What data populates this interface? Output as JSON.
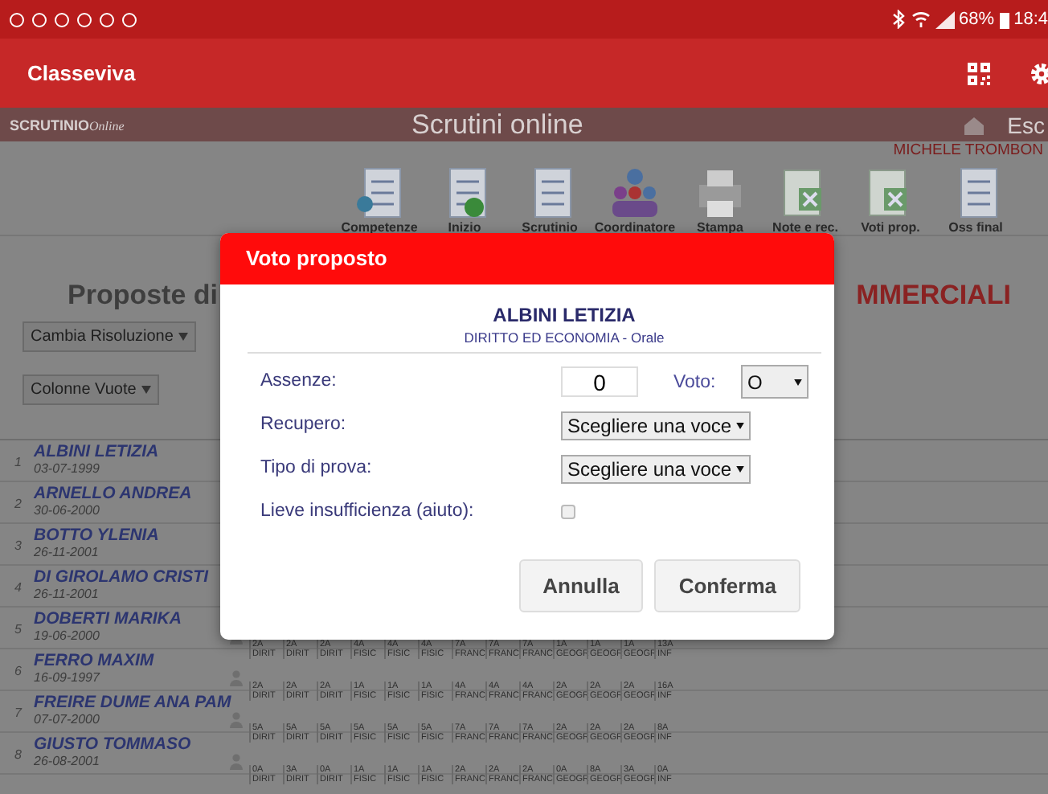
{
  "status_bar": {
    "battery": "68%",
    "time": "18:4"
  },
  "app_bar": {
    "title": "Classeviva"
  },
  "site_header": {
    "logo": "SCRUTINIO",
    "logo_sub": "Online",
    "title": "Scrutini online",
    "logout": "Esc",
    "user": "MICHELE TROMBON"
  },
  "toolbar": [
    "Competenze",
    "Inizio",
    "Scrutinio",
    "Coordinatore",
    "Stampa",
    "Note e rec.",
    "Voti prop.",
    "Oss final"
  ],
  "heading": {
    "left": "Proposte di",
    "right": "MMERCIALI"
  },
  "filters": [
    {
      "label": "Cambia Risoluzione"
    },
    {
      "label": "Colonne Vuote"
    }
  ],
  "students": [
    {
      "num": "1",
      "name": "ALBINI LETIZIA",
      "date": "03-07-1999"
    },
    {
      "num": "2",
      "name": "ARNELLO ANDREA",
      "date": "30-06-2000"
    },
    {
      "num": "3",
      "name": "BOTTO YLENIA",
      "date": "26-11-2001"
    },
    {
      "num": "4",
      "name": "DI GIROLAMO CRISTI",
      "date": "26-11-2001"
    },
    {
      "num": "5",
      "name": "DOBERTI MARIKA",
      "date": "19-06-2000",
      "cells": [
        [
          "2A",
          "DIRIT"
        ],
        [
          "2A",
          "DIRIT"
        ],
        [
          "2A",
          "DIRIT"
        ],
        [
          "4A",
          "FISIC"
        ],
        [
          "4A",
          "FISIC"
        ],
        [
          "4A",
          "FISIC"
        ],
        [
          "7A",
          "FRANC"
        ],
        [
          "7A",
          "FRANC"
        ],
        [
          "7A",
          "FRANC"
        ],
        [
          "1A",
          "GEOGR"
        ],
        [
          "1A",
          "GEOGR"
        ],
        [
          "1A",
          "GEOGR"
        ],
        [
          "13A",
          "INF"
        ]
      ]
    },
    {
      "num": "6",
      "name": "FERRO MAXIM",
      "date": "16-09-1997",
      "cells": [
        [
          "2A",
          "DIRIT"
        ],
        [
          "2A",
          "DIRIT"
        ],
        [
          "2A",
          "DIRIT"
        ],
        [
          "1A",
          "FISIC"
        ],
        [
          "1A",
          "FISIC"
        ],
        [
          "1A",
          "FISIC"
        ],
        [
          "4A",
          "FRANC"
        ],
        [
          "4A",
          "FRANC"
        ],
        [
          "4A",
          "FRANC"
        ],
        [
          "2A",
          "GEOGR"
        ],
        [
          "2A",
          "GEOGR"
        ],
        [
          "2A",
          "GEOGR"
        ],
        [
          "16A",
          "INF"
        ]
      ]
    },
    {
      "num": "7",
      "name": "FREIRE DUME ANA PAM",
      "date": "07-07-2000",
      "cells": [
        [
          "5A",
          "DIRIT"
        ],
        [
          "5A",
          "DIRIT"
        ],
        [
          "5A",
          "DIRIT"
        ],
        [
          "5A",
          "FISIC"
        ],
        [
          "5A",
          "FISIC"
        ],
        [
          "5A",
          "FISIC"
        ],
        [
          "7A",
          "FRANC"
        ],
        [
          "7A",
          "FRANC"
        ],
        [
          "7A",
          "FRANC"
        ],
        [
          "2A",
          "GEOGR"
        ],
        [
          "2A",
          "GEOGR"
        ],
        [
          "2A",
          "GEOGR"
        ],
        [
          "8A",
          "INF"
        ]
      ]
    },
    {
      "num": "8",
      "name": "GIUSTO TOMMASO",
      "date": "26-08-2001",
      "cells": [
        [
          "0A",
          "DIRIT"
        ],
        [
          "3A",
          "DIRIT"
        ],
        [
          "0A",
          "DIRIT"
        ],
        [
          "1A",
          "FISIC"
        ],
        [
          "1A",
          "FISIC"
        ],
        [
          "1A",
          "FISIC"
        ],
        [
          "2A",
          "FRANC"
        ],
        [
          "2A",
          "FRANC"
        ],
        [
          "2A",
          "FRANC"
        ],
        [
          "0A",
          "GEOGR"
        ],
        [
          "8A",
          "GEOGR"
        ],
        [
          "3A",
          "GEOGR"
        ],
        [
          "0A",
          "INF"
        ]
      ]
    }
  ],
  "dialog": {
    "title": "Voto proposto",
    "student": "ALBINI LETIZIA",
    "subject": "DIRITTO ED ECONOMIA - Orale",
    "absences_label": "Assenze:",
    "absences": "0",
    "grade_label": "Voto:",
    "grade": "O",
    "recovery_label": "Recupero:",
    "recovery": "Scegliere una voce",
    "test_label": "Tipo di prova:",
    "test": "Scegliere una voce",
    "help_label": "Lieve insufficienza (aiuto):",
    "help_checked": false,
    "buttons": [
      "Annulla",
      "Conferma"
    ]
  }
}
